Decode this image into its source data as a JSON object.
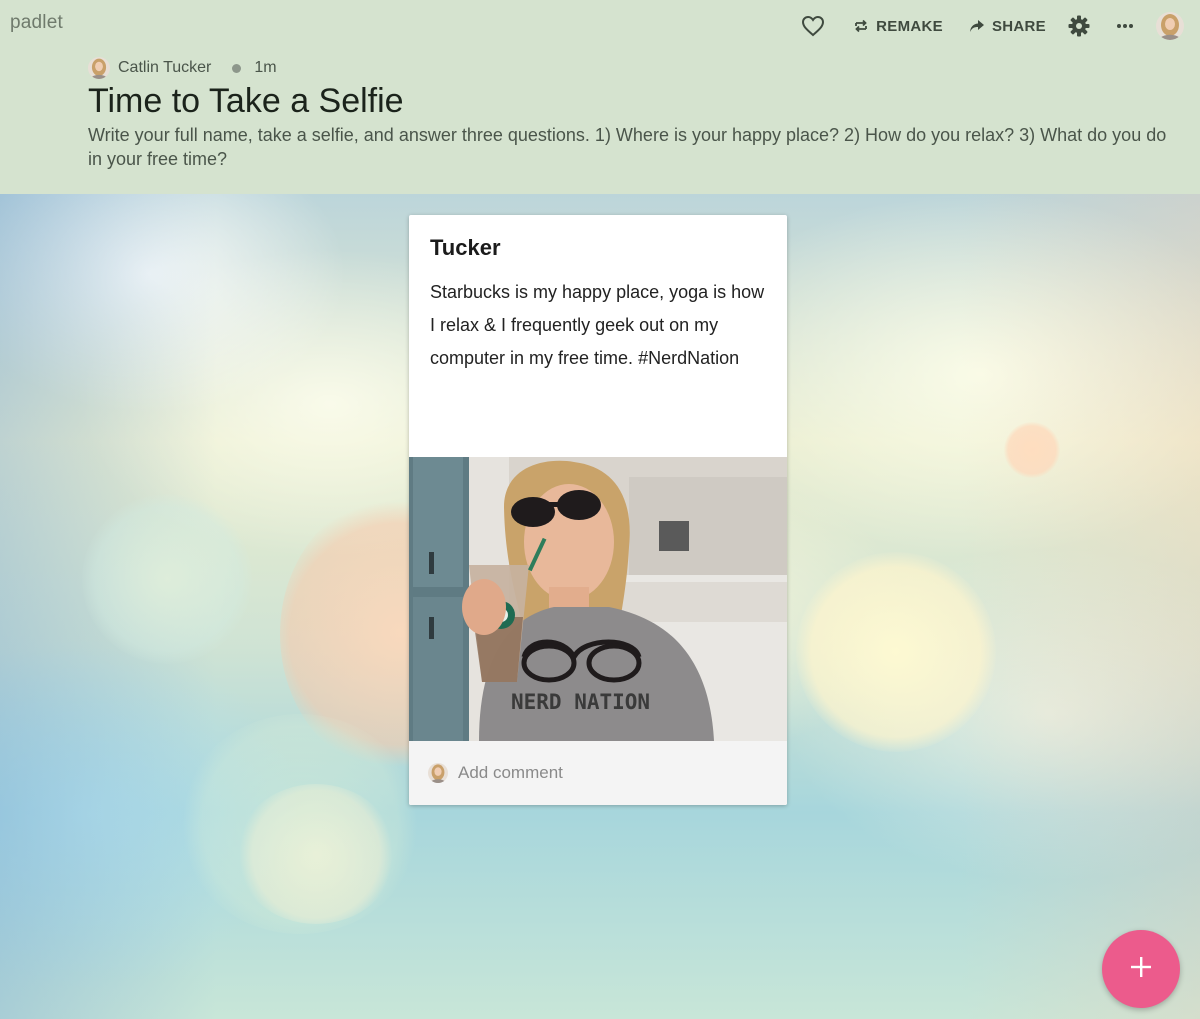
{
  "app": {
    "logo": "padlet"
  },
  "toolbar": {
    "like_icon": "heart-icon",
    "remake_label": "REMAKE",
    "share_label": "SHARE",
    "settings_icon": "gear-icon",
    "more_icon": "more-horizontal-icon"
  },
  "header": {
    "author": "Catlin Tucker",
    "time_ago": "1m",
    "title": "Time to Take a Selfie",
    "description": "Write your full name, take a selfie, and answer three questions. 1) Where is your happy place? 2) How do you relax? 3) What do you do in your free time?"
  },
  "post": {
    "title": "Tucker",
    "body": "Starbucks is my happy place, yoga is how I relax  & I frequently geek out on my computer in my free time. #NerdNation",
    "image_caption_text": "NERD NATION",
    "comment_placeholder": "Add comment"
  },
  "fab": {
    "icon": "plus-icon"
  },
  "colors": {
    "header_bg": "#d5e3cf",
    "fab": "#ec5b8c",
    "card_bg": "#ffffff"
  }
}
